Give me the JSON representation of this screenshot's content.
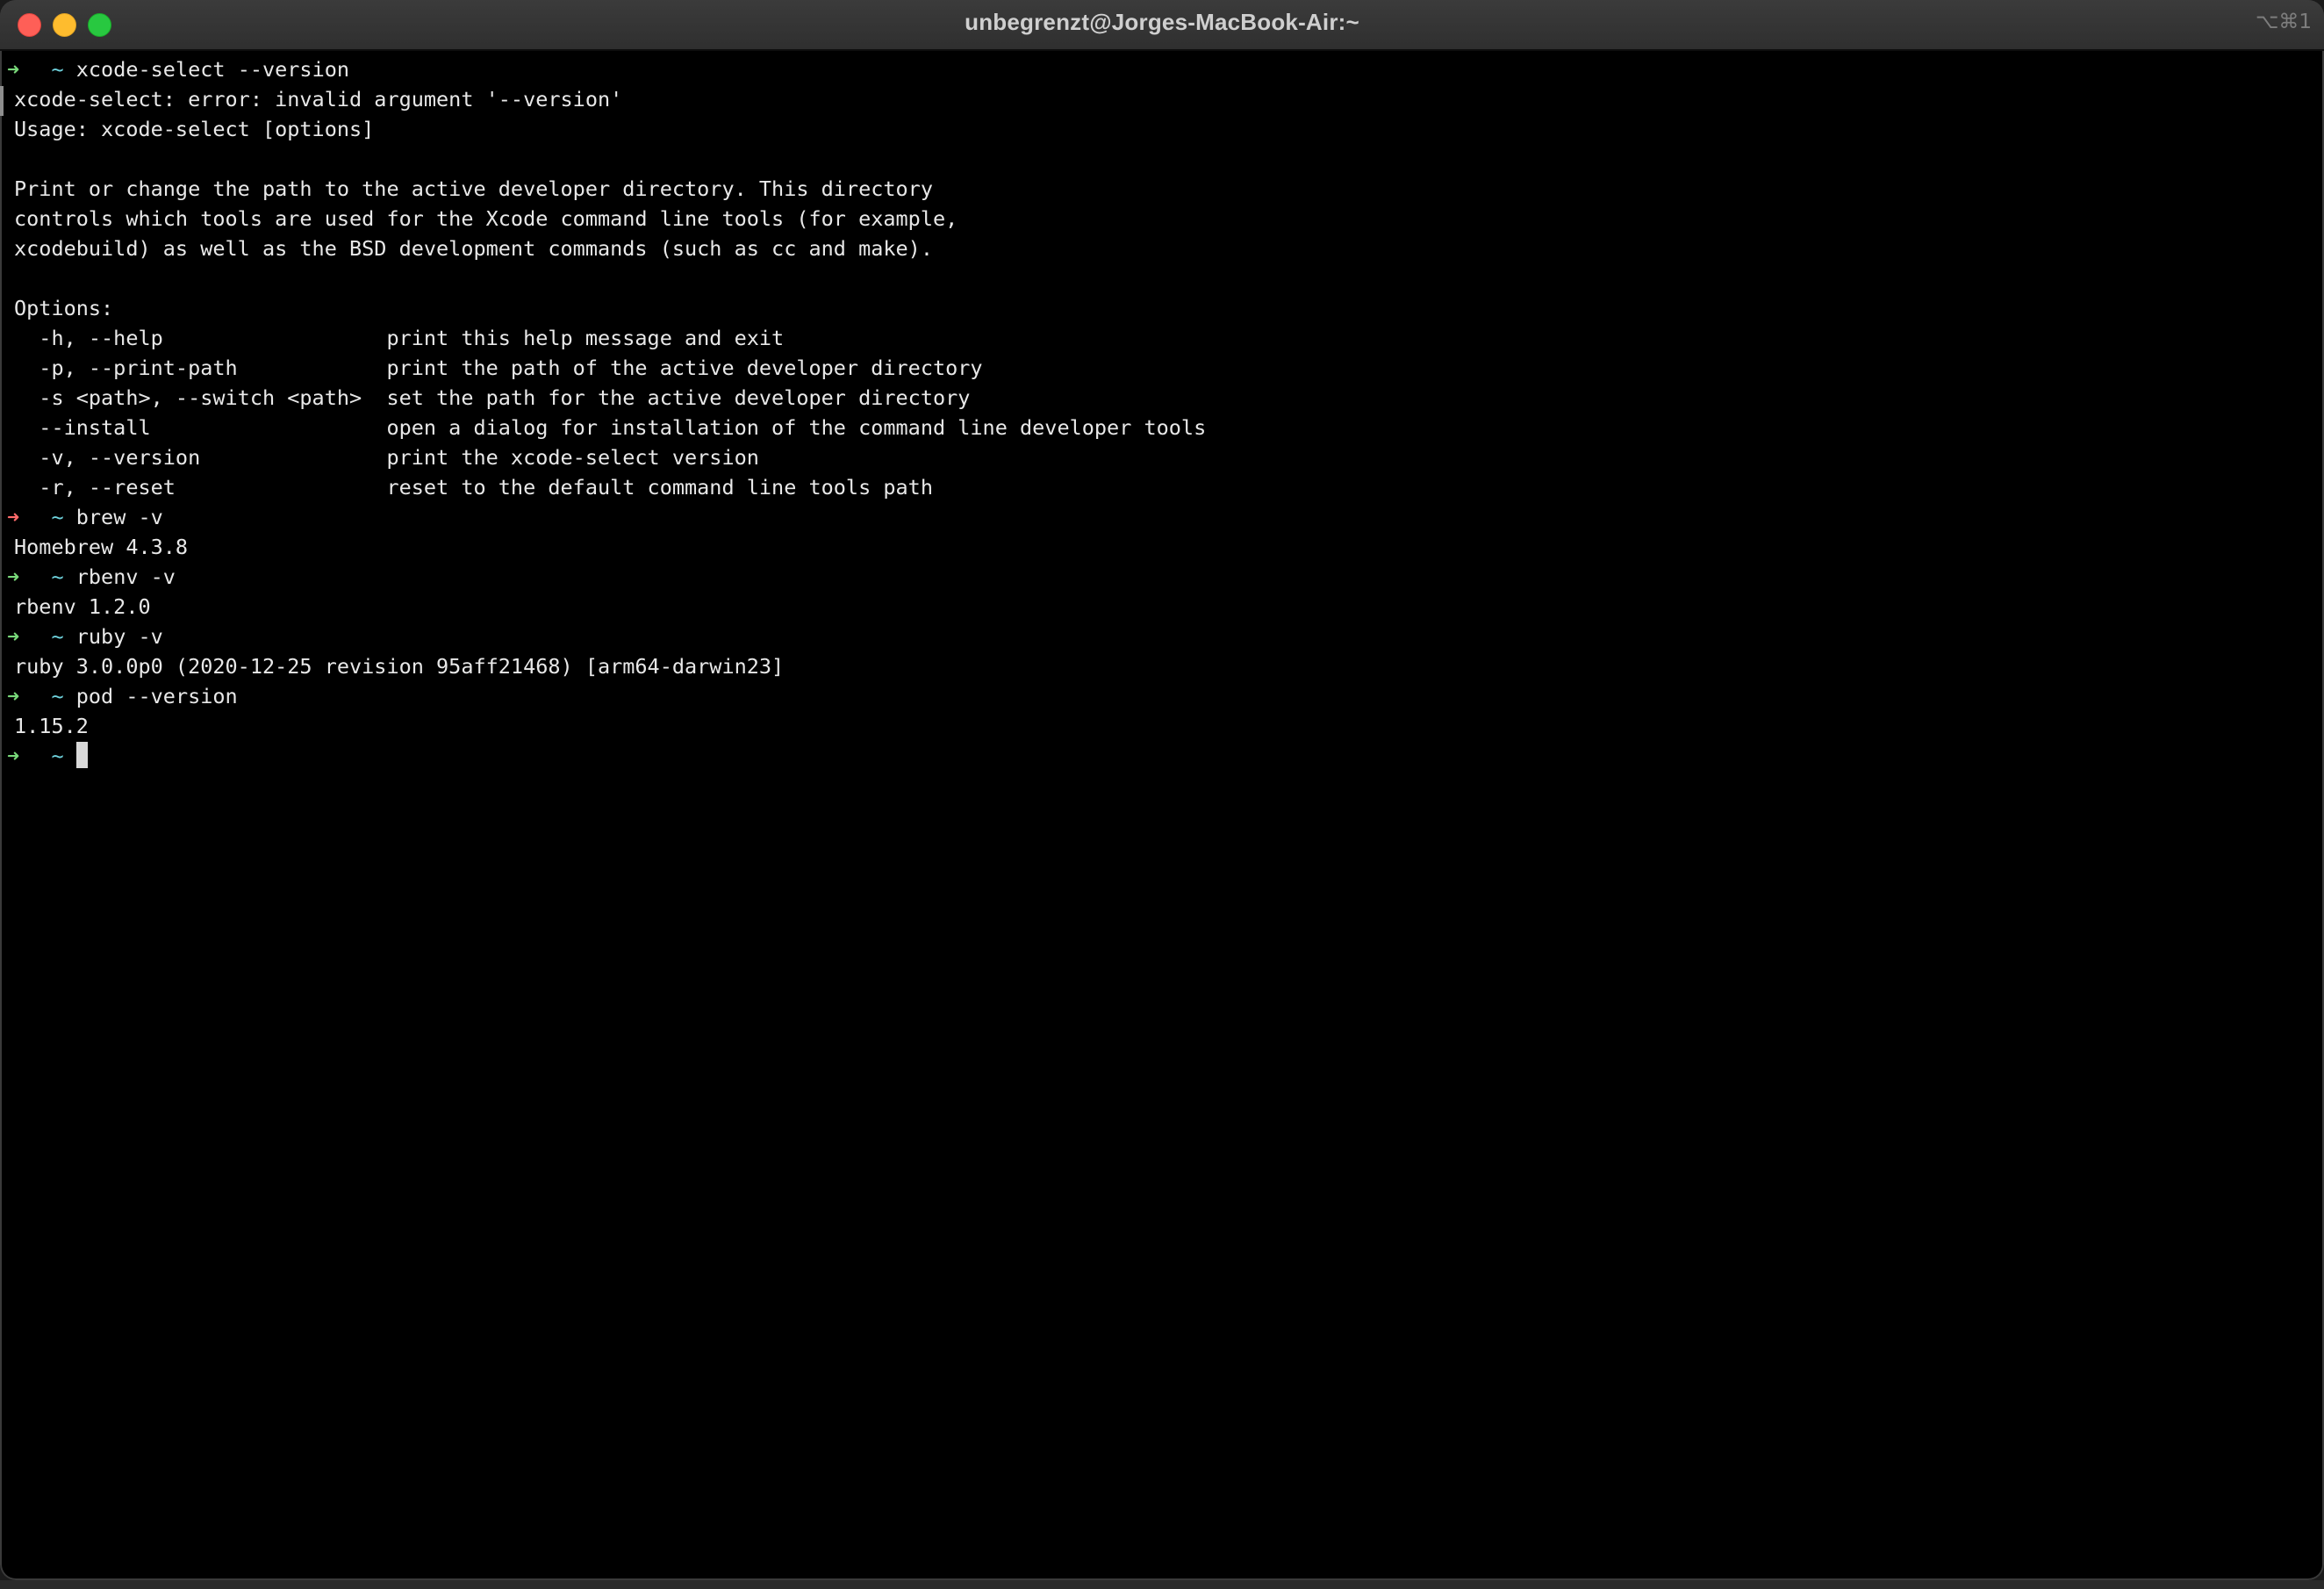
{
  "window": {
    "title": "unbegrenzt@Jorges-MacBook-Air:~",
    "shortcut": "⌥⌘1"
  },
  "terminal": {
    "prompt_symbol": "➜",
    "prompt_dir": "~",
    "lines": [
      {
        "kind": "prompt",
        "status": "ok",
        "command": "xcode-select --version"
      },
      {
        "kind": "output",
        "text": "xcode-select: error: invalid argument '--version'"
      },
      {
        "kind": "output",
        "text": "Usage: xcode-select [options]"
      },
      {
        "kind": "output",
        "text": ""
      },
      {
        "kind": "output",
        "text": "Print or change the path to the active developer directory. This directory"
      },
      {
        "kind": "output",
        "text": "controls which tools are used for the Xcode command line tools (for example,"
      },
      {
        "kind": "output",
        "text": "xcodebuild) as well as the BSD development commands (such as cc and make)."
      },
      {
        "kind": "output",
        "text": ""
      },
      {
        "kind": "output",
        "text": "Options:"
      },
      {
        "kind": "output",
        "text": "  -h, --help                  print this help message and exit"
      },
      {
        "kind": "output",
        "text": "  -p, --print-path            print the path of the active developer directory"
      },
      {
        "kind": "output",
        "text": "  -s <path>, --switch <path>  set the path for the active developer directory"
      },
      {
        "kind": "output",
        "text": "  --install                   open a dialog for installation of the command line developer tools"
      },
      {
        "kind": "output",
        "text": "  -v, --version               print the xcode-select version"
      },
      {
        "kind": "output",
        "text": "  -r, --reset                 reset to the default command line tools path"
      },
      {
        "kind": "prompt",
        "status": "err",
        "command": "brew -v"
      },
      {
        "kind": "output",
        "text": "Homebrew 4.3.8"
      },
      {
        "kind": "prompt",
        "status": "ok",
        "command": "rbenv -v"
      },
      {
        "kind": "output",
        "text": "rbenv 1.2.0"
      },
      {
        "kind": "prompt",
        "status": "ok",
        "command": "ruby -v"
      },
      {
        "kind": "output",
        "text": "ruby 3.0.0p0 (2020-12-25 revision 95aff21468) [arm64-darwin23]"
      },
      {
        "kind": "prompt",
        "status": "ok",
        "command": "pod --version"
      },
      {
        "kind": "output",
        "text": "1.15.2"
      },
      {
        "kind": "prompt",
        "status": "ok",
        "command": "",
        "cursor": true
      }
    ]
  },
  "colors": {
    "background": "#000000",
    "text": "#e8e8e8",
    "prompt_ok": "#79d97a",
    "prompt_err": "#ff6b6b",
    "prompt_dir": "#6fd3de"
  }
}
